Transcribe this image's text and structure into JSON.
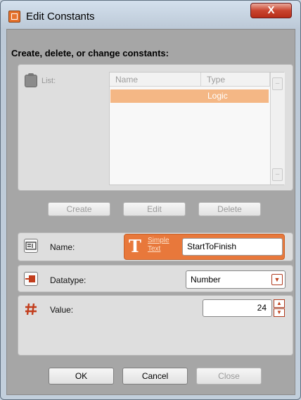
{
  "window": {
    "title": "Edit Constants",
    "close_label": "X"
  },
  "heading": "Create, delete, or change constants:",
  "list": {
    "label": "List:",
    "columns": [
      "Name",
      "Type"
    ],
    "rows": [
      {
        "name": "",
        "type": "Logic"
      }
    ],
    "scroll_up": "–",
    "scroll_down": "–"
  },
  "list_buttons": {
    "create": "Create",
    "edit": "Edit",
    "delete": "Delete"
  },
  "name_field": {
    "label": "Name:",
    "type_link": "Simple Text",
    "value": "StartToFinish"
  },
  "datatype_field": {
    "label": "Datatype:",
    "value": "Number"
  },
  "value_field": {
    "label": "Value:",
    "value": "24"
  },
  "footer": {
    "ok": "OK",
    "cancel": "Cancel",
    "close": "Close"
  },
  "colors": {
    "accent": "#e8783b",
    "selection": "#f4b785",
    "client": "#a6a6a6",
    "panel": "#dedede"
  },
  "icons": {
    "app": "app-window-icon",
    "list": "clipboard-icon",
    "name": "name-tag-icon",
    "text_type": "text-T-icon",
    "datatype": "datatype-icon",
    "value": "hash-icon"
  }
}
